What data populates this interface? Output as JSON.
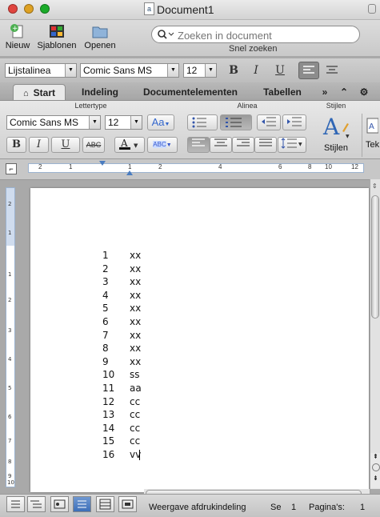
{
  "window": {
    "title": "Document1"
  },
  "toolbar": {
    "new_label": "Nieuw",
    "templates_label": "Sjablonen",
    "open_label": "Openen",
    "search_placeholder": "Zoeken in document",
    "search_caption": "Snel zoeken"
  },
  "formatbar": {
    "style": "Lijstalinea",
    "font": "Comic Sans MS",
    "size": "12",
    "bold": "B",
    "italic": "I",
    "underline": "U"
  },
  "tabs": [
    "Start",
    "Indeling",
    "Documentelementen",
    "Tabellen"
  ],
  "ribbon": {
    "group_font": "Lettertype",
    "group_paragraph": "Alinea",
    "group_styles": "Stijlen",
    "font": "Comic Sans MS",
    "size": "12",
    "change_case": "Aa",
    "bold": "B",
    "italic": "I",
    "underline": "U",
    "strike": "ABC",
    "highlight": "ABC",
    "styles_button": "Stijlen",
    "text_cut": "Tek"
  },
  "ruler": {
    "labels": [
      "2",
      "1",
      "1",
      "2",
      "4",
      "6",
      "8",
      "10",
      "12"
    ]
  },
  "vruler": {
    "labels": [
      "2",
      "1",
      "1",
      "2",
      "3",
      "4",
      "5",
      "6",
      "7",
      "8",
      "9",
      "10"
    ]
  },
  "document": {
    "rows": [
      {
        "n": "1",
        "t": "xx"
      },
      {
        "n": "2",
        "t": "xx"
      },
      {
        "n": "3",
        "t": "xx"
      },
      {
        "n": "4",
        "t": "xx"
      },
      {
        "n": "5",
        "t": "xx"
      },
      {
        "n": "6",
        "t": "xx"
      },
      {
        "n": "7",
        "t": "xx"
      },
      {
        "n": "8",
        "t": "xx"
      },
      {
        "n": "9",
        "t": "xx"
      },
      {
        "n": "10",
        "t": "ss"
      },
      {
        "n": "11",
        "t": "aa"
      },
      {
        "n": "12",
        "t": "cc"
      },
      {
        "n": "13",
        "t": "cc"
      },
      {
        "n": "14",
        "t": "cc"
      },
      {
        "n": "15",
        "t": "cc"
      },
      {
        "n": "16",
        "t": "vv"
      }
    ]
  },
  "status": {
    "view": "Weergave afdrukindeling",
    "section_label": "Se",
    "section": "1",
    "page_label": "Pagina's:",
    "page": "1"
  }
}
